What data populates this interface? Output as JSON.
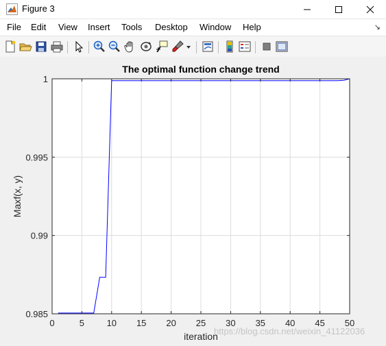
{
  "window": {
    "title": "Figure 3",
    "icon": "matlab-logo-icon",
    "controls": [
      "minimize-icon",
      "maximize-icon",
      "close-icon"
    ]
  },
  "menu": {
    "items": [
      "File",
      "Edit",
      "View",
      "Insert",
      "Tools",
      "Desktop",
      "Window",
      "Help"
    ],
    "overflow_icon": "menu-dock-arrow-icon"
  },
  "toolbar": {
    "buttons": [
      "new-figure-icon",
      "open-file-icon",
      "save-icon",
      "print-icon",
      "edit-plot-arrow-icon",
      "zoom-in-icon",
      "zoom-out-icon",
      "pan-hand-icon",
      "rotate-3d-icon",
      "data-cursor-icon",
      "brush-icon",
      "brush-dropdown-icon",
      "link-plot-icon",
      "insert-colorbar-icon",
      "insert-legend-icon",
      "hide-plot-tools-icon",
      "show-plot-tools-icon"
    ]
  },
  "colors": {
    "line": "#0000ff",
    "axes_bg": "#ffffff",
    "figure_bg": "#f0f0f0",
    "grid": "#dcdcdc"
  },
  "watermark": "https://blog.csdn.net/weixin_41122036",
  "chart_data": {
    "type": "line",
    "title": "The optimal function change trend",
    "xlabel": "iteration",
    "ylabel": "Maxf(x, y)",
    "xlim": [
      0,
      50
    ],
    "ylim": [
      0.985,
      1
    ],
    "xticks": [
      0,
      5,
      10,
      15,
      20,
      25,
      30,
      35,
      40,
      45,
      50
    ],
    "yticks": [
      0.985,
      0.99,
      0.995,
      1
    ],
    "ytick_labels": [
      "0.985",
      "0.99",
      "0.995",
      "1"
    ],
    "grid": true,
    "series": [
      {
        "color": "#0000ff",
        "x": [
          1,
          2,
          3,
          4,
          5,
          6,
          7,
          8,
          9,
          10,
          11,
          12,
          13,
          14,
          15,
          16,
          17,
          18,
          19,
          20,
          21,
          22,
          23,
          24,
          25,
          26,
          27,
          28,
          29,
          30,
          31,
          32,
          33,
          34,
          35,
          36,
          37,
          38,
          39,
          40,
          41,
          42,
          43,
          44,
          45,
          46,
          47,
          48,
          49,
          50
        ],
        "y": [
          0.98505,
          0.98505,
          0.98505,
          0.98505,
          0.98505,
          0.98505,
          0.98505,
          0.98733,
          0.98733,
          0.99988,
          0.99988,
          0.99988,
          0.99988,
          0.99988,
          0.99988,
          0.99988,
          0.99988,
          0.99988,
          0.99988,
          0.99988,
          0.99988,
          0.99988,
          0.99988,
          0.99988,
          0.99988,
          0.99988,
          0.99988,
          0.99988,
          0.99988,
          0.99988,
          0.99988,
          0.99988,
          0.99988,
          0.99988,
          0.99988,
          0.99988,
          0.99988,
          0.99988,
          0.99988,
          0.99988,
          0.99988,
          0.99988,
          0.99988,
          0.99988,
          0.99988,
          0.99988,
          0.99988,
          0.99988,
          0.9999,
          1.0
        ]
      }
    ]
  }
}
